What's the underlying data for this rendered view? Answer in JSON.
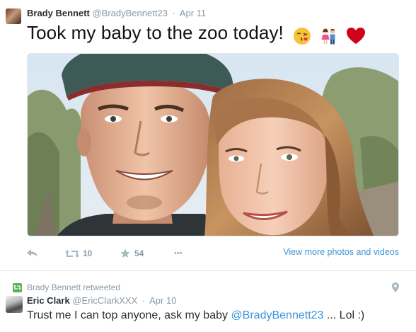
{
  "tweet1": {
    "fullname": "Brady Bennett",
    "username": "@BradyBennett23",
    "separator": "·",
    "time": "Apr 11",
    "text": "Took my baby to the zoo today!",
    "emojis": [
      "face-blowing-kiss-emoji",
      "couple-emoji",
      "red-heart-emoji"
    ],
    "retweet_count": "10",
    "favorite_count": "54",
    "more_label": "•••",
    "view_more_label": "View more photos and videos"
  },
  "retweet_context": {
    "label": "Brady Bennett retweeted"
  },
  "tweet2": {
    "fullname": "Eric Clark",
    "username": "@EricClarkXXX",
    "separator": "·",
    "time": "Apr 10",
    "text_before": "Trust me I can top anyone, ask my baby ",
    "mention": "@BradyBennett23",
    "text_after": " ... Lol :)"
  },
  "colors": {
    "link": "#3b94d9",
    "muted": "#8899a6",
    "text": "#292f33",
    "retweet_green": "#5dae5b",
    "heart_red": "#d0021b"
  }
}
